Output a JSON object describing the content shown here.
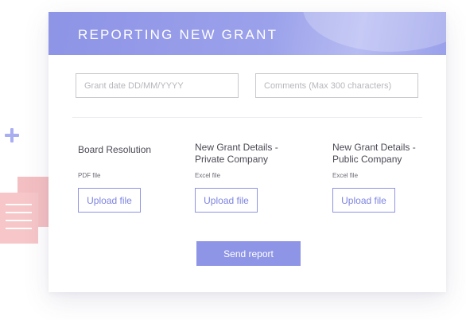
{
  "header": {
    "title": "REPORTING NEW GRANT"
  },
  "form": {
    "grant_date_placeholder": "Grant date DD/MM/YYYY",
    "grant_date_value": "",
    "comments_placeholder": "Comments (Max 300 characters)",
    "comments_value": ""
  },
  "uploads": [
    {
      "title": "Board Resolution",
      "file_type": "PDF file",
      "button_label": "Upload file"
    },
    {
      "title": "New Grant Details -\nPrivate Company",
      "file_type": "Excel file",
      "button_label": "Upload file"
    },
    {
      "title": "New Grant Details -\nPublic Company",
      "file_type": "Excel file",
      "button_label": "Upload file"
    }
  ],
  "actions": {
    "send_label": "Send report"
  },
  "decorations": {
    "plus_icon": "plus-icon",
    "document_icon": "document-stack-icon"
  },
  "colors": {
    "accent": "#8f95e6",
    "header_gradient_start": "#8e94e6",
    "header_gradient_end": "#b6bbf2",
    "document_pink": "#f6c6c8",
    "border": "#c9c9cf",
    "text": "#4a4a55"
  }
}
